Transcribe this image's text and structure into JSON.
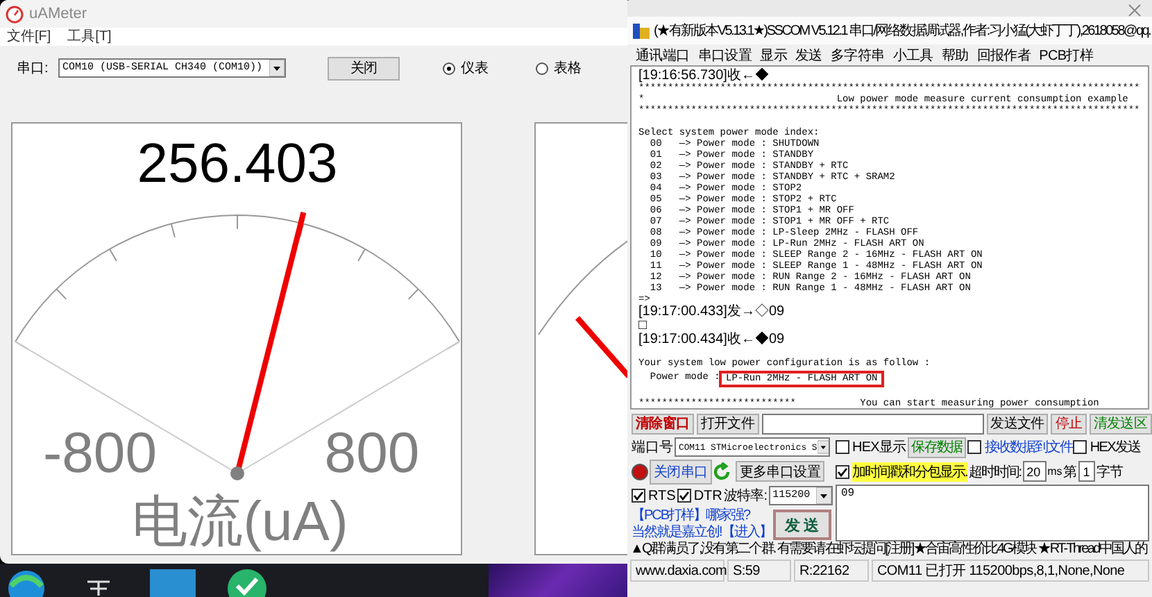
{
  "uameter": {
    "title": "uAMeter",
    "menu": [
      "文件[F]",
      "工具[T]"
    ],
    "port_label": "串口:",
    "port_value": "COM10 (USB-SERIAL CH340 (COM10))",
    "close_button": "关闭",
    "view_modes": [
      {
        "label": "仪表",
        "selected": true
      },
      {
        "label": "表格",
        "selected": false
      }
    ],
    "gauge": {
      "reading": "256.403",
      "level": 0.62,
      "min_label": "-800",
      "max_label": "800",
      "unit_label": "电流(uA)"
    }
  },
  "sscom": {
    "title": "(★有新版本V5.13.1★)SSCOM V5.12.1 串口/网络数据调试器,作者:习小猛(大虾丁丁),2618058@qq.",
    "menu": [
      "通讯端口",
      "串口设置",
      "显示",
      "发送",
      "多字符串",
      "小工具",
      "帮助",
      "回报作者",
      "PCB打样"
    ],
    "log_lines": [
      {
        "kind": "stamp",
        "text": "[19:16:56.730]收←◆"
      },
      {
        "kind": "text",
        "text": "**************************************************************************************"
      },
      {
        "kind": "text",
        "text": "*                                 Low power mode measure current consumption example"
      },
      {
        "kind": "text",
        "text": "**************************************************************************************"
      },
      {
        "kind": "blank"
      },
      {
        "kind": "text",
        "text": "Select system power mode index:"
      },
      {
        "kind": "text",
        "text": "  00   —> Power mode : SHUTDOWN"
      },
      {
        "kind": "text",
        "text": "  01   —> Power mode : STANDBY"
      },
      {
        "kind": "text",
        "text": "  02   —> Power mode : STANDBY + RTC"
      },
      {
        "kind": "text",
        "text": "  03   —> Power mode : STANDBY + RTC + SRAM2"
      },
      {
        "kind": "text",
        "text": "  04   —> Power mode : STOP2"
      },
      {
        "kind": "text",
        "text": "  05   —> Power mode : STOP2 + RTC"
      },
      {
        "kind": "text",
        "text": "  06   —> Power mode : STOP1 + MR OFF"
      },
      {
        "kind": "text",
        "text": "  07   —> Power mode : STOP1 + MR OFF + RTC"
      },
      {
        "kind": "text",
        "text": "  08   —> Power mode : LP-Sleep 2MHz - FLASH OFF"
      },
      {
        "kind": "text",
        "text": "  09   —> Power mode : LP-Run 2MHz - FLASH ART ON"
      },
      {
        "kind": "text",
        "text": "  10   —> Power mode : SLEEP Range 2 - 16MHz - FLASH ART ON"
      },
      {
        "kind": "text",
        "text": "  11   —> Power mode : SLEEP Range 1 - 48MHz - FLASH ART ON"
      },
      {
        "kind": "text",
        "text": "  12   —> Power mode : RUN Range 2 - 16MHz - FLASH ART ON"
      },
      {
        "kind": "text",
        "text": "  13   —> Power mode : RUN Range 1 - 48MHz - FLASH ART ON"
      },
      {
        "kind": "text",
        "text": "=>"
      },
      {
        "kind": "stamp",
        "text": "[19:17:00.433]发→◇09"
      },
      {
        "kind": "stamp",
        "text": "□"
      },
      {
        "kind": "stamp",
        "text": "[19:17:00.434]收←◆09"
      },
      {
        "kind": "blank"
      },
      {
        "kind": "text",
        "text": "Your system low power configuration is as follow :"
      },
      {
        "kind": "boxed",
        "text": "  Power mode : ",
        "boxed": "LP-Run 2MHz - FLASH ART ON"
      },
      {
        "kind": "blank"
      },
      {
        "kind": "text",
        "text": "***************************           You can start measuring power consumption"
      }
    ],
    "clear_button": "清除窗口",
    "open_file_button": "打开文件",
    "send_file_button": "发送文件",
    "stop_button": "停止",
    "clear_send_button": "清发送区",
    "port_label": "端口号",
    "port_value": "COM11 STMicroelectronics S",
    "hex_display": {
      "label": "HEX显示",
      "checked": false
    },
    "save_data_button": "保存数据",
    "receive_to_file": {
      "label": "接收数据到文件",
      "checked": false
    },
    "hex_send": {
      "label": "HEX发送",
      "checked": false
    },
    "close_port_button": "关闭串口",
    "more_settings_button": "更多串口设置",
    "timestamp": {
      "label": "加时间戳和分包显示.",
      "checked": true
    },
    "timeout_label": "超时时间:",
    "timeout_value": "20",
    "timeout_unit": "ms",
    "byte_label": "第",
    "byte_value": "1",
    "byte_unit": "字节",
    "rts": {
      "label": "RTS",
      "checked": true
    },
    "dtr": {
      "label": "DTR",
      "checked": true
    },
    "baud_label": "波特率:",
    "baud_value": "115200",
    "ad_links": [
      "【PCB打样】哪家强?",
      "当然就是嘉立创!【进入】"
    ],
    "send_button": "发 送",
    "send_text": "09",
    "marquee": "▲Q群满员了,没有第二个群. 有需要请在虾坛提问[注册]★合宙高性价比4G模块 ★RT-Thread中国人的",
    "status_bar": [
      "www.daxia.com",
      "S:59",
      "R:22162",
      "COM11 已打开  115200bps,8,1,None,None"
    ]
  }
}
